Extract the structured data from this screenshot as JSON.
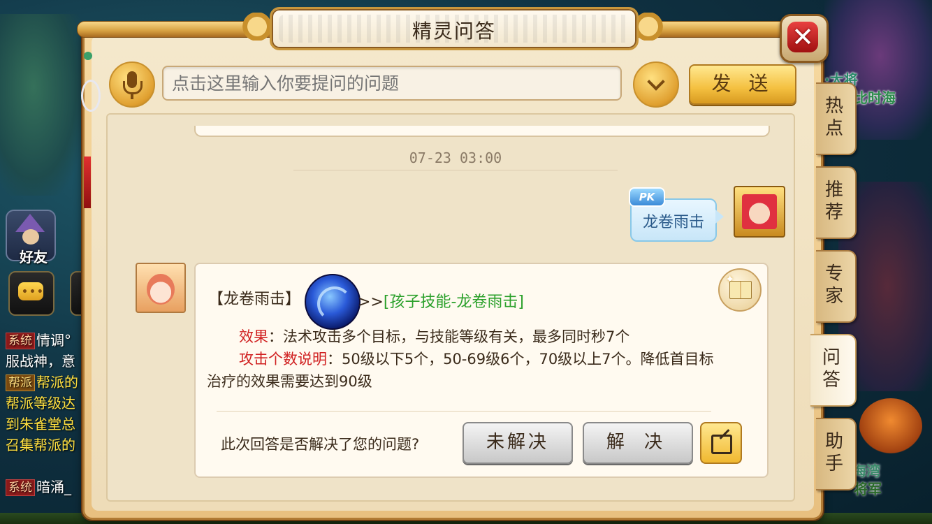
{
  "dialog": {
    "title": "精灵问答",
    "close_label": "✕"
  },
  "input": {
    "placeholder": "点击这里输入你要提问的问题",
    "send_label": "发 送"
  },
  "conversation": {
    "timestamp": "07-23 03:00",
    "user_message": "龙卷雨击",
    "user_badge": "PK",
    "answer": {
      "skill_name": "【龙卷雨击】",
      "link_arrows": ">>",
      "link_text": "[孩子技能-龙卷雨击]",
      "effect_label": "效果",
      "effect_text": "：法术攻击多个目标，与技能等级有关，最多同时秒7个",
      "count_label": "攻击个数说明",
      "count_text": "：50级以下5个，50-69级6个，70级以上7个。降低首目标",
      "count_text_2": "治疗的效果需要达到90级"
    },
    "feedback_question": "此次回答是否解决了您的问题?",
    "unsolved_label": "未解决",
    "solved_label": "解 决"
  },
  "side_tabs": [
    {
      "label": "热点",
      "active": false
    },
    {
      "label": "推荐",
      "active": false
    },
    {
      "label": "专家",
      "active": false
    },
    {
      "label": "问答",
      "active": true
    },
    {
      "label": "助手",
      "active": false
    }
  ],
  "background": {
    "friend_label": "好友",
    "chat_button_glyph": "•••",
    "chat": [
      {
        "tag": "系统",
        "text": "情调°"
      },
      {
        "tag": "",
        "text": "服战神，意"
      },
      {
        "tag": "帮派",
        "text": "帮派的"
      },
      {
        "tag": "",
        "text": "帮派等级达"
      },
      {
        "tag": "",
        "text": "到朱雀堂总"
      },
      {
        "tag": "",
        "text": "召集帮派的"
      },
      {
        "tag": "系统",
        "text": "暗涌_"
      }
    ],
    "right_top_1": "·大将",
    "right_top_2": "比时海",
    "right_bottom_1": "海湾",
    "right_bottom_2": "将军"
  },
  "colors": {
    "accent_gold": "#f4c040",
    "effect_red": "#d02020",
    "link_green": "#2aa02a",
    "frame_brown": "#b07a34"
  },
  "icons": {
    "voice": "microphone-icon",
    "dropdown": "chevron-down-icon",
    "close": "close-icon",
    "book": "book-icon",
    "share": "share-icon"
  }
}
